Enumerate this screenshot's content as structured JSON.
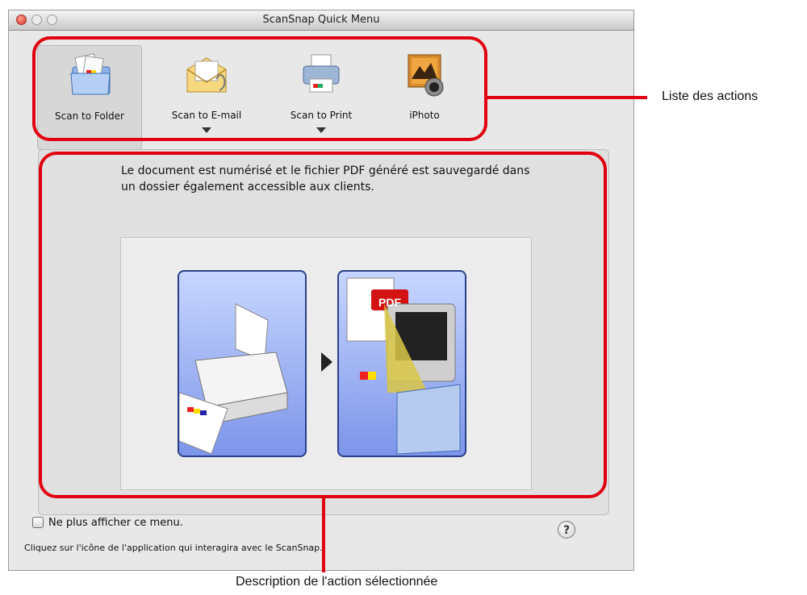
{
  "window": {
    "title": "ScanSnap Quick Menu"
  },
  "actions": [
    {
      "label": "Scan to Folder",
      "icon": "folder-doc-icon",
      "selected": true,
      "has_menu": false
    },
    {
      "label": "Scan to E-mail",
      "icon": "envelope-icon",
      "selected": false,
      "has_menu": true
    },
    {
      "label": "Scan to Print",
      "icon": "printer-icon",
      "selected": false,
      "has_menu": true
    },
    {
      "label": "iPhoto",
      "icon": "iphoto-icon",
      "selected": false,
      "has_menu": false
    }
  ],
  "description": "Le document est numérisé et le fichier PDF généré est sauvegardé dans un dossier également accessible aux clients.",
  "illustration": {
    "pdf_badge": "PDF"
  },
  "footer": {
    "checkbox_label": "Ne plus afficher ce menu.",
    "checkbox_checked": false,
    "hint": "Cliquez sur l'icône de l'application qui interagira avec le ScanSnap.",
    "help_label": "?"
  },
  "callouts": {
    "actions_list": "Liste des actions",
    "selected_description": "Description de l'action sélectionnée"
  },
  "colors": {
    "highlight": "#e0000f",
    "card_border": "#2a3f8a"
  }
}
